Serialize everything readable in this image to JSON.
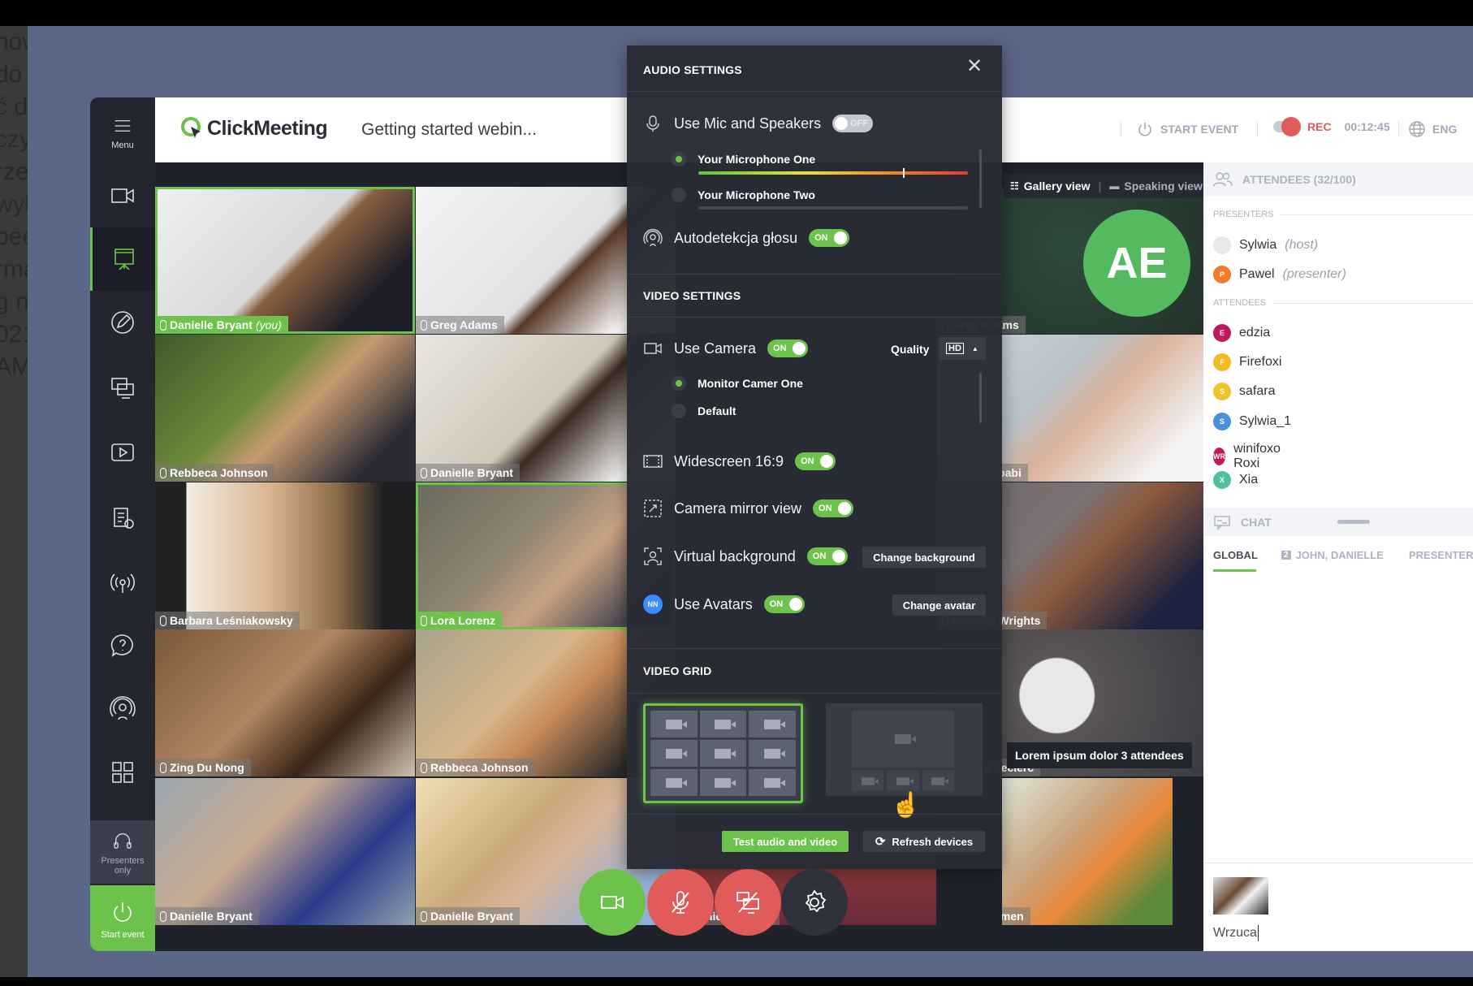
{
  "background_fragments": [
    "now",
    "do",
    "ć d",
    "czy",
    "rze",
    "wył",
    "pee",
    "",
    "rma",
    "g n",
    "",
    "",
    "",
    "",
    "",
    "",
    "",
    "",
    "",
    "",
    "021",
    "AM"
  ],
  "sidebar": {
    "menu_label": "Menu",
    "items": [
      "camera",
      "presentation",
      "whiteboard",
      "screen-share",
      "video",
      "tests",
      "broadcast",
      "chat-help",
      "streaming",
      "layouts"
    ],
    "presenters_only": "Presenters only",
    "start_event": "Start event"
  },
  "header": {
    "brand": "ClickMeeting",
    "title": "Getting started webin...",
    "start_event": "START EVENT",
    "rec": "REC",
    "timer": "00:12:45",
    "language": "ENG"
  },
  "view_switch": {
    "gallery": "Gallery view",
    "speaking": "Speaking view"
  },
  "tiles": [
    {
      "name": "Danielle Bryant",
      "suffix": "(you)"
    },
    {
      "name": "Greg Adams"
    },
    {
      "name": ""
    },
    {
      "name": "Greg Adams",
      "initials": "AE"
    },
    {
      "name": "Rebbeca Johnson"
    },
    {
      "name": "Danielle Bryant"
    },
    {
      "name": ""
    },
    {
      "name": "Lora Arababi"
    },
    {
      "name": "Barbara Leśniakowsky"
    },
    {
      "name": "Lora Lorenz"
    },
    {
      "name": ""
    },
    {
      "name": "Dorothy Wrights"
    },
    {
      "name": "Zing Du Nong"
    },
    {
      "name": "Rebbeca Johnson"
    },
    {
      "name": ""
    },
    {
      "name": "Monica Leclerc"
    },
    {
      "name": "Danielle Bryant"
    },
    {
      "name": "Danielle Bryant"
    },
    {
      "name": "Daniel Schmitd"
    },
    {
      "name": "Greg Oldmen"
    }
  ],
  "tooltip": "Lorem ipsum dolor 3 attendees",
  "dialog": {
    "audio_title": "AUDIO SETTINGS",
    "use_mic": "Use Mic and Speakers",
    "use_mic_state": "OFF",
    "mics": [
      {
        "label": "Your Microphone One",
        "selected": true,
        "level": 0.76
      },
      {
        "label": "Your Microphone Two",
        "selected": false,
        "level": 0
      }
    ],
    "autodetect": "Autodetekcja głosu",
    "autodetect_state": "ON",
    "video_title": "VIDEO SETTINGS",
    "use_camera": "Use Camera",
    "use_camera_state": "ON",
    "quality_label": "Quality",
    "quality_value": "HD",
    "cameras": [
      {
        "label": "Monitor Camer One",
        "selected": true
      },
      {
        "label": "Default",
        "selected": false
      }
    ],
    "widescreen": "Widescreen 16:9",
    "widescreen_state": "ON",
    "mirror": "Camera mirror view",
    "mirror_state": "ON",
    "virtual_bg": "Virtual background",
    "virtual_bg_state": "ON",
    "change_background": "Change background",
    "avatars": "Use Avatars",
    "avatars_state": "ON",
    "avatar_initials": "NN",
    "change_avatar": "Change avatar",
    "grid_title": "VIDEO GRID",
    "grid_selected": "gallery",
    "test_button": "Test audio and video",
    "refresh_button": "Refresh devices"
  },
  "right": {
    "attendees_header": "ATTENDEES (32/100)",
    "presenters_label": "PRESENTERS",
    "presenters": [
      {
        "name": "Sylwia",
        "role": "(host)",
        "initial": "",
        "color": "#e6e8ec"
      },
      {
        "name": "Pawel",
        "role": "(presenter)",
        "initial": "P",
        "color": "#f07b2e"
      }
    ],
    "attendees_label": "ATTENDEES",
    "attendees": [
      {
        "name": "edzia",
        "initial": "E",
        "color": "#c2185b"
      },
      {
        "name": "Firefoxi",
        "initial": "F",
        "color": "#f7b924"
      },
      {
        "name": "safara",
        "initial": "S",
        "color": "#f2c12e"
      },
      {
        "name": "Sylwia_1",
        "initial": "S",
        "color": "#4a90d9"
      },
      {
        "name": "winifoxo Roxi",
        "initial": "WR",
        "color": "#c2185b"
      },
      {
        "name": "Xia",
        "initial": "X",
        "color": "#4dc1a1"
      }
    ],
    "chat_header": "CHAT",
    "chat_tabs": [
      {
        "label": "GLOBAL",
        "active": true
      },
      {
        "label": "JOHN, DANIELLE",
        "badge": "2"
      },
      {
        "label": "PRESENTERS"
      }
    ],
    "chat_input": "Wrzuca"
  },
  "colors": {
    "accent": "#6cc24a",
    "record": "#e25b5b",
    "background": "#5c6688"
  }
}
